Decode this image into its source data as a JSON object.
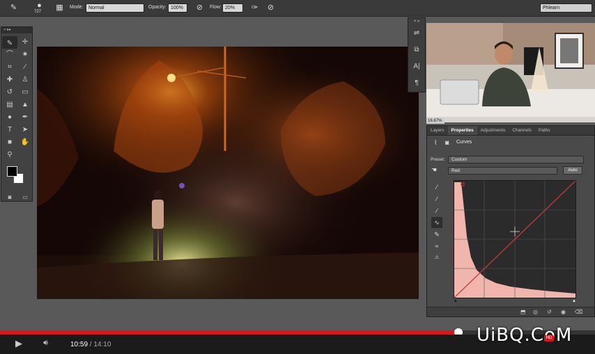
{
  "options_bar": {
    "brush_size": "727",
    "mode_label": "Mode:",
    "mode_value": "Normal",
    "opacity_label": "Opacity:",
    "opacity_value": "100%",
    "flow_label": "Flow:",
    "flow_value": "20%",
    "workspace_value": "Phlearn"
  },
  "properties": {
    "tabs": [
      "Layers",
      "Properties",
      "Adjustments",
      "Channels",
      "Paths"
    ],
    "active_tab": "Properties",
    "title": "Curves",
    "preset_label": "Preset:",
    "preset_value": "Custom",
    "channel_value": "Red",
    "auto_label": "Auto",
    "zoom_label": "16.67%"
  },
  "player": {
    "current_time": "10:59",
    "separator": " / ",
    "total_time": "14:10",
    "progress": 0.77,
    "hd_badge": "HD"
  },
  "watermark": "UiBQ.CoM",
  "colors": {
    "accent": "#d8161c",
    "curve_fill": "#f0b6ad",
    "curve_line": "#c23a3a"
  }
}
